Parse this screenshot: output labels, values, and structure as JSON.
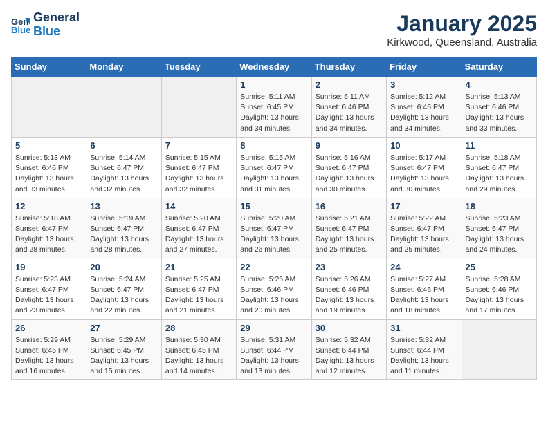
{
  "logo": {
    "line1": "General",
    "line2": "Blue"
  },
  "title": "January 2025",
  "location": "Kirkwood, Queensland, Australia",
  "weekdays": [
    "Sunday",
    "Monday",
    "Tuesday",
    "Wednesday",
    "Thursday",
    "Friday",
    "Saturday"
  ],
  "weeks": [
    [
      {
        "day": "",
        "info": ""
      },
      {
        "day": "",
        "info": ""
      },
      {
        "day": "",
        "info": ""
      },
      {
        "day": "1",
        "info": "Sunrise: 5:11 AM\nSunset: 6:45 PM\nDaylight: 13 hours\nand 34 minutes."
      },
      {
        "day": "2",
        "info": "Sunrise: 5:11 AM\nSunset: 6:46 PM\nDaylight: 13 hours\nand 34 minutes."
      },
      {
        "day": "3",
        "info": "Sunrise: 5:12 AM\nSunset: 6:46 PM\nDaylight: 13 hours\nand 34 minutes."
      },
      {
        "day": "4",
        "info": "Sunrise: 5:13 AM\nSunset: 6:46 PM\nDaylight: 13 hours\nand 33 minutes."
      }
    ],
    [
      {
        "day": "5",
        "info": "Sunrise: 5:13 AM\nSunset: 6:46 PM\nDaylight: 13 hours\nand 33 minutes."
      },
      {
        "day": "6",
        "info": "Sunrise: 5:14 AM\nSunset: 6:47 PM\nDaylight: 13 hours\nand 32 minutes."
      },
      {
        "day": "7",
        "info": "Sunrise: 5:15 AM\nSunset: 6:47 PM\nDaylight: 13 hours\nand 32 minutes."
      },
      {
        "day": "8",
        "info": "Sunrise: 5:15 AM\nSunset: 6:47 PM\nDaylight: 13 hours\nand 31 minutes."
      },
      {
        "day": "9",
        "info": "Sunrise: 5:16 AM\nSunset: 6:47 PM\nDaylight: 13 hours\nand 30 minutes."
      },
      {
        "day": "10",
        "info": "Sunrise: 5:17 AM\nSunset: 6:47 PM\nDaylight: 13 hours\nand 30 minutes."
      },
      {
        "day": "11",
        "info": "Sunrise: 5:18 AM\nSunset: 6:47 PM\nDaylight: 13 hours\nand 29 minutes."
      }
    ],
    [
      {
        "day": "12",
        "info": "Sunrise: 5:18 AM\nSunset: 6:47 PM\nDaylight: 13 hours\nand 28 minutes."
      },
      {
        "day": "13",
        "info": "Sunrise: 5:19 AM\nSunset: 6:47 PM\nDaylight: 13 hours\nand 28 minutes."
      },
      {
        "day": "14",
        "info": "Sunrise: 5:20 AM\nSunset: 6:47 PM\nDaylight: 13 hours\nand 27 minutes."
      },
      {
        "day": "15",
        "info": "Sunrise: 5:20 AM\nSunset: 6:47 PM\nDaylight: 13 hours\nand 26 minutes."
      },
      {
        "day": "16",
        "info": "Sunrise: 5:21 AM\nSunset: 6:47 PM\nDaylight: 13 hours\nand 25 minutes."
      },
      {
        "day": "17",
        "info": "Sunrise: 5:22 AM\nSunset: 6:47 PM\nDaylight: 13 hours\nand 25 minutes."
      },
      {
        "day": "18",
        "info": "Sunrise: 5:23 AM\nSunset: 6:47 PM\nDaylight: 13 hours\nand 24 minutes."
      }
    ],
    [
      {
        "day": "19",
        "info": "Sunrise: 5:23 AM\nSunset: 6:47 PM\nDaylight: 13 hours\nand 23 minutes."
      },
      {
        "day": "20",
        "info": "Sunrise: 5:24 AM\nSunset: 6:47 PM\nDaylight: 13 hours\nand 22 minutes."
      },
      {
        "day": "21",
        "info": "Sunrise: 5:25 AM\nSunset: 6:47 PM\nDaylight: 13 hours\nand 21 minutes."
      },
      {
        "day": "22",
        "info": "Sunrise: 5:26 AM\nSunset: 6:46 PM\nDaylight: 13 hours\nand 20 minutes."
      },
      {
        "day": "23",
        "info": "Sunrise: 5:26 AM\nSunset: 6:46 PM\nDaylight: 13 hours\nand 19 minutes."
      },
      {
        "day": "24",
        "info": "Sunrise: 5:27 AM\nSunset: 6:46 PM\nDaylight: 13 hours\nand 18 minutes."
      },
      {
        "day": "25",
        "info": "Sunrise: 5:28 AM\nSunset: 6:46 PM\nDaylight: 13 hours\nand 17 minutes."
      }
    ],
    [
      {
        "day": "26",
        "info": "Sunrise: 5:29 AM\nSunset: 6:45 PM\nDaylight: 13 hours\nand 16 minutes."
      },
      {
        "day": "27",
        "info": "Sunrise: 5:29 AM\nSunset: 6:45 PM\nDaylight: 13 hours\nand 15 minutes."
      },
      {
        "day": "28",
        "info": "Sunrise: 5:30 AM\nSunset: 6:45 PM\nDaylight: 13 hours\nand 14 minutes."
      },
      {
        "day": "29",
        "info": "Sunrise: 5:31 AM\nSunset: 6:44 PM\nDaylight: 13 hours\nand 13 minutes."
      },
      {
        "day": "30",
        "info": "Sunrise: 5:32 AM\nSunset: 6:44 PM\nDaylight: 13 hours\nand 12 minutes."
      },
      {
        "day": "31",
        "info": "Sunrise: 5:32 AM\nSunset: 6:44 PM\nDaylight: 13 hours\nand 11 minutes."
      },
      {
        "day": "",
        "info": ""
      }
    ]
  ]
}
